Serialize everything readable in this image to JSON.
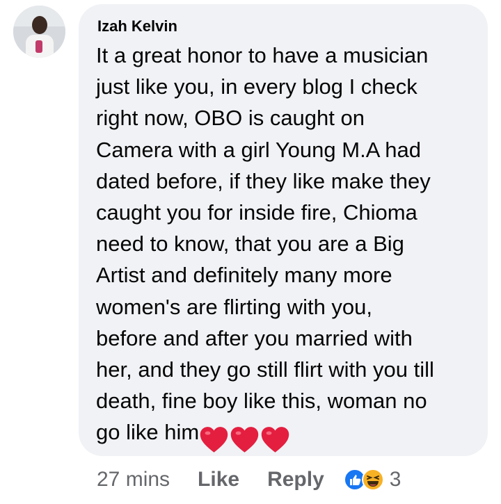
{
  "comment": {
    "author": "Izah Kelvin",
    "lines": [
      "It a great honor to have a musician",
      "just like you, in every blog I check",
      "right now, OBO is caught on",
      "Camera with a girl Young M.A had",
      "dated before, if they like make they",
      "caught you for inside fire, Chioma",
      "need to know, that you are a Big",
      "Artist and definitely many more",
      "women's are flirting with you,",
      "before and after you married with",
      "her, and they go still flirt with you till",
      "death, fine boy like this, woman no",
      "go like him"
    ],
    "emoji": [
      "heart-icon",
      "heart-icon",
      "heart-icon"
    ]
  },
  "actions": {
    "time": "27 mins",
    "like_label": "Like",
    "reply_label": "Reply",
    "reaction_icons": [
      "like-reaction-icon",
      "haha-reaction-icon"
    ],
    "reaction_count": "3"
  },
  "colors": {
    "bubble": "#f0f2f5",
    "text": "#050505",
    "secondary": "#65676b",
    "heart": "#e41e3f",
    "like_blue": "#1877f2",
    "haha_yellow": "#f7b125"
  }
}
